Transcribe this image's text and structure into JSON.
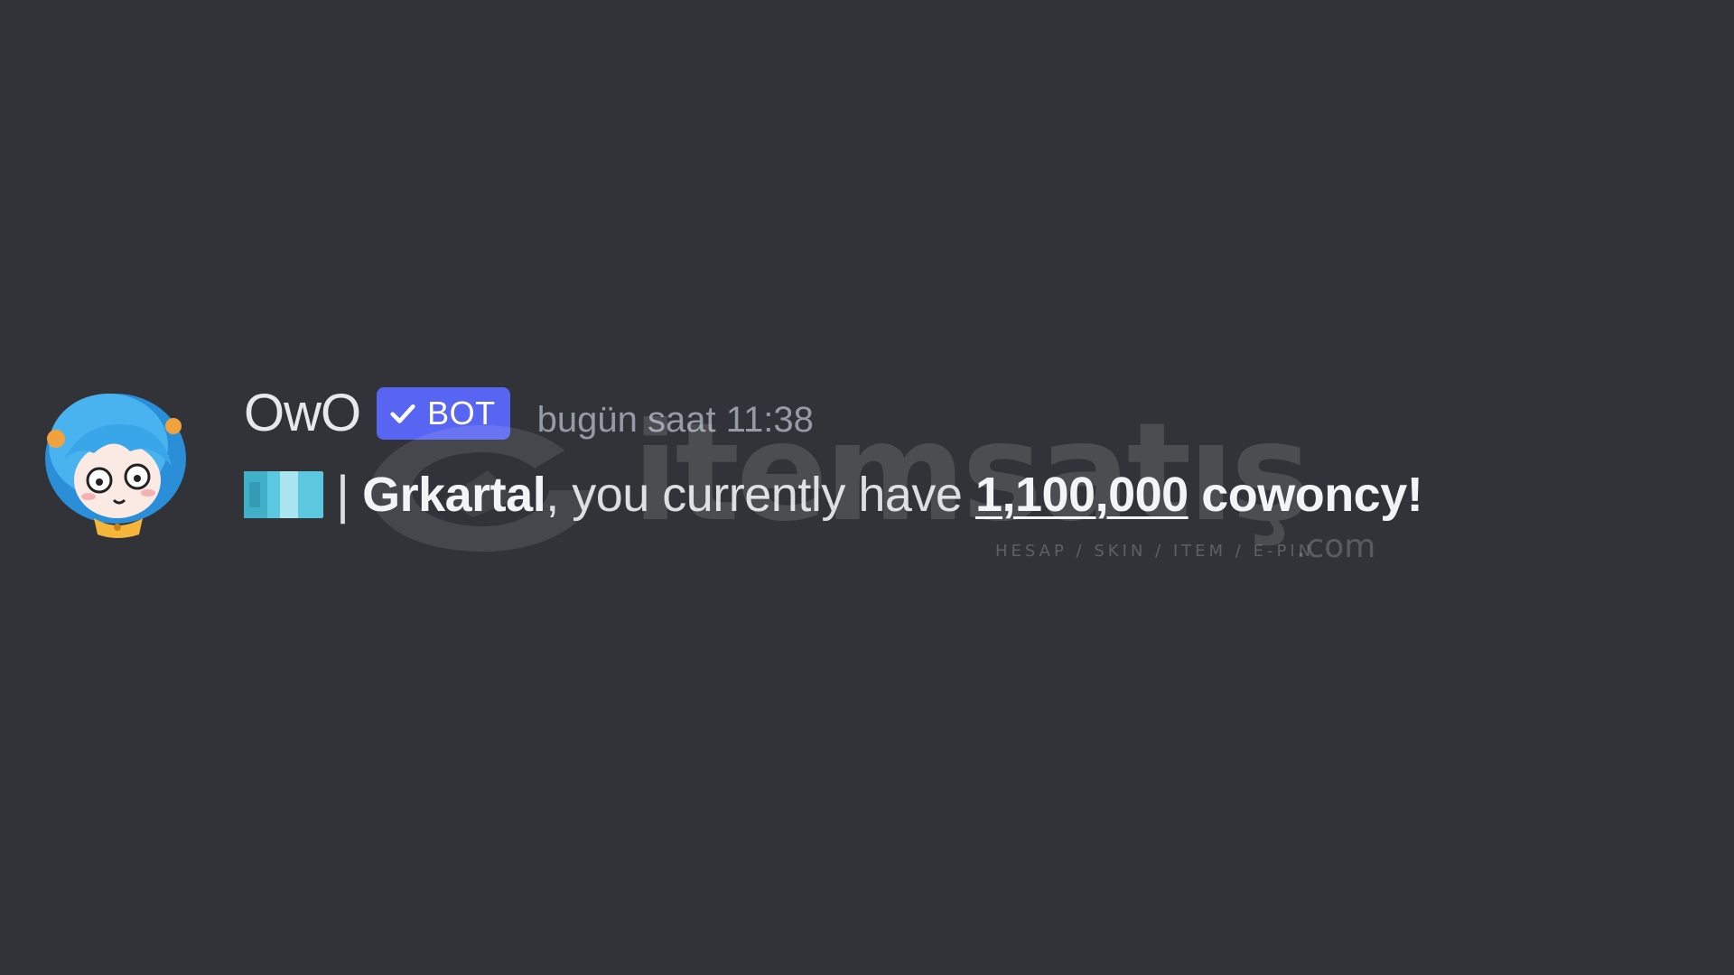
{
  "message": {
    "username": "OwO",
    "badge": {
      "label": "BOT",
      "icon": "check-icon"
    },
    "timestamp": "bugün saat 11:38",
    "avatar_icon": "owo-avatar",
    "content": {
      "icon": "cowoncy-icon",
      "separator": "|",
      "mention": "Grkartal",
      "text_after_mention": ", you currently have ",
      "amount": "1,100,000",
      "text_after_amount": " cowoncy!"
    }
  },
  "watermark": {
    "brand": "itemsatış",
    "tagline": "HESAP / SKIN / ITEM / E-PIN",
    "tld": ".com"
  },
  "colors": {
    "background": "#313338",
    "badge": "#5865f2",
    "text": "#dbdee1",
    "timestamp": "#949ba4"
  }
}
